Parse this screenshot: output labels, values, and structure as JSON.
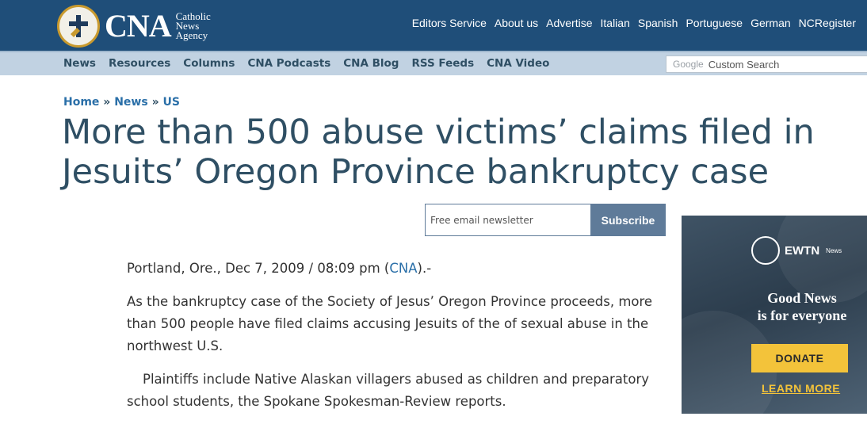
{
  "header": {
    "logo_text": "CNA",
    "logo_sub_1": "Catholic",
    "logo_sub_2": "News",
    "logo_sub_3": "Agency",
    "nav": [
      "Editors Service",
      "About us",
      "Advertise",
      "Italian",
      "Spanish",
      "Portuguese",
      "German",
      "NCRegister"
    ],
    "brand_color": "#1f4e79"
  },
  "subnav": {
    "items": [
      "News",
      "Resources",
      "Columns",
      "CNA Podcasts",
      "CNA Blog",
      "RSS Feeds",
      "CNA Video"
    ],
    "search_brand": "Google",
    "search_placeholder": "Custom Search"
  },
  "breadcrumb": {
    "home": "Home",
    "news": "News",
    "us": "US",
    "sep": "»"
  },
  "article": {
    "headline": "More than 500 abuse victims’ claims filed in Jesuits’ Oregon Province bankruptcy case",
    "dateline_prefix": "Portland, Ore., Dec 7, 2009 / 08:09 pm (",
    "dateline_source": "CNA",
    "dateline_suffix": ").-",
    "paragraph_1": "As the bankruptcy case of the Society of Jesus’ Oregon Province proceeds, more than 500 people have filed claims accusing Jesuits of the of sexual abuse in the northwest U.S.",
    "paragraph_2": "Plaintiffs include Native Alaskan villagers abused as children and preparatory school students, the Spokane Spokesman-Review reports."
  },
  "newsletter": {
    "placeholder": "Free email newsletter",
    "button": "Subscribe"
  },
  "ad": {
    "brand": "EWTN",
    "brand_sub": "News",
    "headline_1": "Good News",
    "headline_2": "is for everyone",
    "donate": "DONATE",
    "learn_more": "LEARN MORE",
    "accent_color": "#f3c33a"
  }
}
